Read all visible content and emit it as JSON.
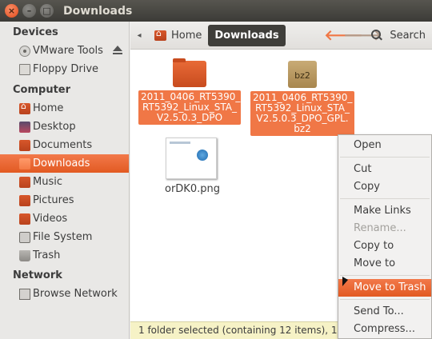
{
  "window": {
    "title": "Downloads"
  },
  "sidebar": {
    "sections": [
      {
        "title": "Devices",
        "items": [
          {
            "label": "VMware Tools",
            "icon": "disk-icon",
            "eject": true
          },
          {
            "label": "Floppy Drive",
            "icon": "floppy-icon"
          }
        ]
      },
      {
        "title": "Computer",
        "items": [
          {
            "label": "Home",
            "icon": "home-folder-icon"
          },
          {
            "label": "Desktop",
            "icon": "desktop-icon"
          },
          {
            "label": "Documents",
            "icon": "folder-icon"
          },
          {
            "label": "Downloads",
            "icon": "folder-icon",
            "selected": true
          },
          {
            "label": "Music",
            "icon": "folder-icon"
          },
          {
            "label": "Pictures",
            "icon": "folder-icon"
          },
          {
            "label": "Videos",
            "icon": "folder-icon"
          },
          {
            "label": "File System",
            "icon": "drive-icon"
          },
          {
            "label": "Trash",
            "icon": "trash-icon"
          }
        ]
      },
      {
        "title": "Network",
        "items": [
          {
            "label": "Browse Network",
            "icon": "network-icon"
          }
        ]
      }
    ]
  },
  "toolbar": {
    "breadcrumbs": [
      "Home",
      "Downloads"
    ],
    "search_label": "Search"
  },
  "files": [
    {
      "name": "2011_0406_RT5390_RT5392_Linux_STA_V2.5.0.3_DPO",
      "lines": [
        "2011_0406_RT5390_",
        "RT5392_Linux_STA_",
        "V2.5.0.3_DPO"
      ],
      "type": "folder",
      "selected": true
    },
    {
      "name": "2011_0406_RT5390_RT5392_Linux_STA_V2.5.0.3_DPO_GPL.bz2",
      "lines": [
        "2011_0406_RT5390_",
        "RT5392_Linux_STA_",
        "V2.5.0.3_DPO_GPL.",
        "bz2"
      ],
      "type": "archive",
      "badge": "bz2",
      "selected": true
    },
    {
      "name": "orDK0.png",
      "lines": [
        "orDK0.png"
      ],
      "type": "image",
      "selected": false
    }
  ],
  "status": {
    "text": "1 folder selected (containing 12 items), 1"
  },
  "context_menu": {
    "items": [
      {
        "label": "Open"
      },
      {
        "separator": true
      },
      {
        "label": "Cut"
      },
      {
        "label": "Copy"
      },
      {
        "separator": true
      },
      {
        "label": "Make Links"
      },
      {
        "label": "Rename...",
        "disabled": true
      },
      {
        "label": "Copy to"
      },
      {
        "label": "Move to"
      },
      {
        "separator": true
      },
      {
        "label": "Move to Trash",
        "highlighted": true
      },
      {
        "separator": true
      },
      {
        "label": "Send To..."
      },
      {
        "label": "Compress..."
      }
    ]
  },
  "colors": {
    "accent": "#f07746",
    "titlebar": "#3c3b37",
    "status_bg": "#f6f2c6"
  }
}
